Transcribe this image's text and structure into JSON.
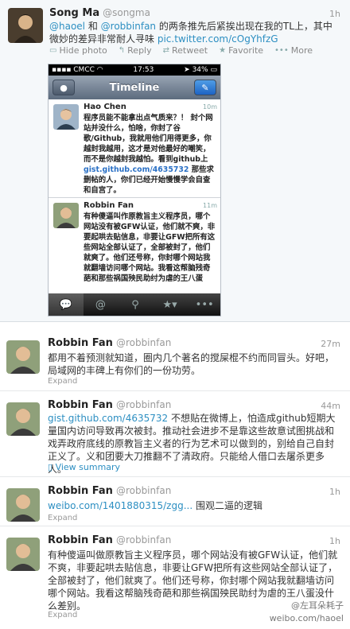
{
  "top_tweet": {
    "name": "Song Ma",
    "handle": "@songma",
    "time": "1h",
    "text_parts": [
      "@haoel",
      " 和 ",
      "@robbinfan",
      " 的两条推先后紧挨出现在我的TL上，其中微妙的差异非常耐人寻味 ",
      "pic.twitter.com/cOgYhfzG"
    ],
    "actions": {
      "hide_photo": "Hide photo",
      "reply": "Reply",
      "retweet": "Retweet",
      "favorite": "Favorite",
      "more": "More"
    }
  },
  "phone": {
    "carrier": "CMCC",
    "clock": "17:53",
    "battery": "34%",
    "nav_title": "Timeline",
    "tweets": [
      {
        "name": "Hao Chen",
        "time": "10m",
        "text": "程序员能不能拿出点气质来？！ 封个网站并没什么，怕啥，你封了谷歌/Github，我就用他们用得更多，你越封我越用，这才是对他最好的嘲笑，而不是你越封我越怕。看到github上",
        "link": "gist.github.com/4635732",
        "text_after": " 那些求删帖的人，你们已经开始慢慢学会自查和自宫了。"
      },
      {
        "name": "Robbin Fan",
        "time": "11m",
        "text": "有种傻逼叫作原教旨主义程序员，哪个网站没有被GFW认证，他们就不爽，非要起哄去贴信息，非要让GFW把所有这些网站全部认证了，全部被封了，他们就爽了。他们还号称，你封哪个网站我就翻墙访问哪个网站。我看这帮脑残奇葩和那些祸国殃民助纣为虐的王八蛋"
      }
    ],
    "tabs": [
      "chat-bubble",
      "at-sign",
      "search",
      "star",
      "more"
    ]
  },
  "tweets": [
    {
      "name": "Robbin Fan",
      "handle": "@robbinfan",
      "time": "27m",
      "text": "都用不着预测就知道，圈内几个著名的搅屎棍不约而同冒头。好吧，局域网的丰碑上有你们的一份功劳。",
      "expand": "Expand"
    },
    {
      "name": "Robbin Fan",
      "handle": "@robbinfan",
      "time": "44m",
      "link": "gist.github.com/4635732",
      "text": " 不想贴在微博上，怕造成github短期大量国内访问导致再次被封。推动社会进步不是靠这些故意试图挑战和戏弄政府底线的原教旨主义者的行为艺术可以做到的，别给自己自封正义了。义和团要大刀推翻不了清政府。只能给人借口去屠杀更多人。",
      "summary": "View summary"
    },
    {
      "name": "Robbin Fan",
      "handle": "@robbinfan",
      "time": "1h",
      "link": "weibo.com/1401880315/zgg...",
      "text": " 围观二逼的逻辑",
      "expand": "Expand"
    },
    {
      "name": "Robbin Fan",
      "handle": "@robbinfan",
      "time": "1h",
      "text": "有种傻逼叫做原教旨主义程序员，哪个网站没有被GFW认证，他们就不爽，非要起哄去贴信息，非要让GFW把所有这些网站全部认证了，全部被封了，他们就爽了。他们还号称，你封哪个网站我就翻墙访问哪个网站。我看这帮脑残奇葩和那些祸国殃民助纣为虐的王八蛋没什么差别。",
      "expand": "Expand"
    }
  ],
  "watermark": {
    "line1": "@左耳朵耗子",
    "line2": "weibo.com/haoel"
  },
  "colors": {
    "link": "#2d8fc2",
    "nav_gradient_top": "#98a4b3",
    "compose_button": "#1d63c4"
  }
}
